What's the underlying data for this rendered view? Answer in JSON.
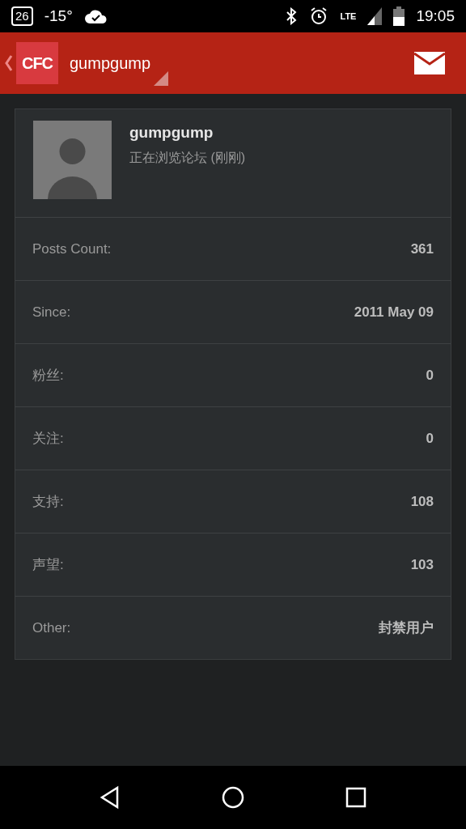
{
  "status_bar": {
    "date": "26",
    "temperature": "-15°",
    "network": "LTE",
    "time": "19:05"
  },
  "app_bar": {
    "logo": "CFC",
    "title": "gumpgump"
  },
  "profile": {
    "name": "gumpgump",
    "status": "正在浏览论坛 (刚刚)"
  },
  "stats": [
    {
      "label": "Posts Count:",
      "value": "361"
    },
    {
      "label": "Since:",
      "value": "2011 May 09"
    },
    {
      "label": "粉丝:",
      "value": "0"
    },
    {
      "label": "关注:",
      "value": "0"
    },
    {
      "label": "支持:",
      "value": "108"
    },
    {
      "label": "声望:",
      "value": "103"
    },
    {
      "label": "Other:",
      "value": "封禁用户"
    }
  ]
}
